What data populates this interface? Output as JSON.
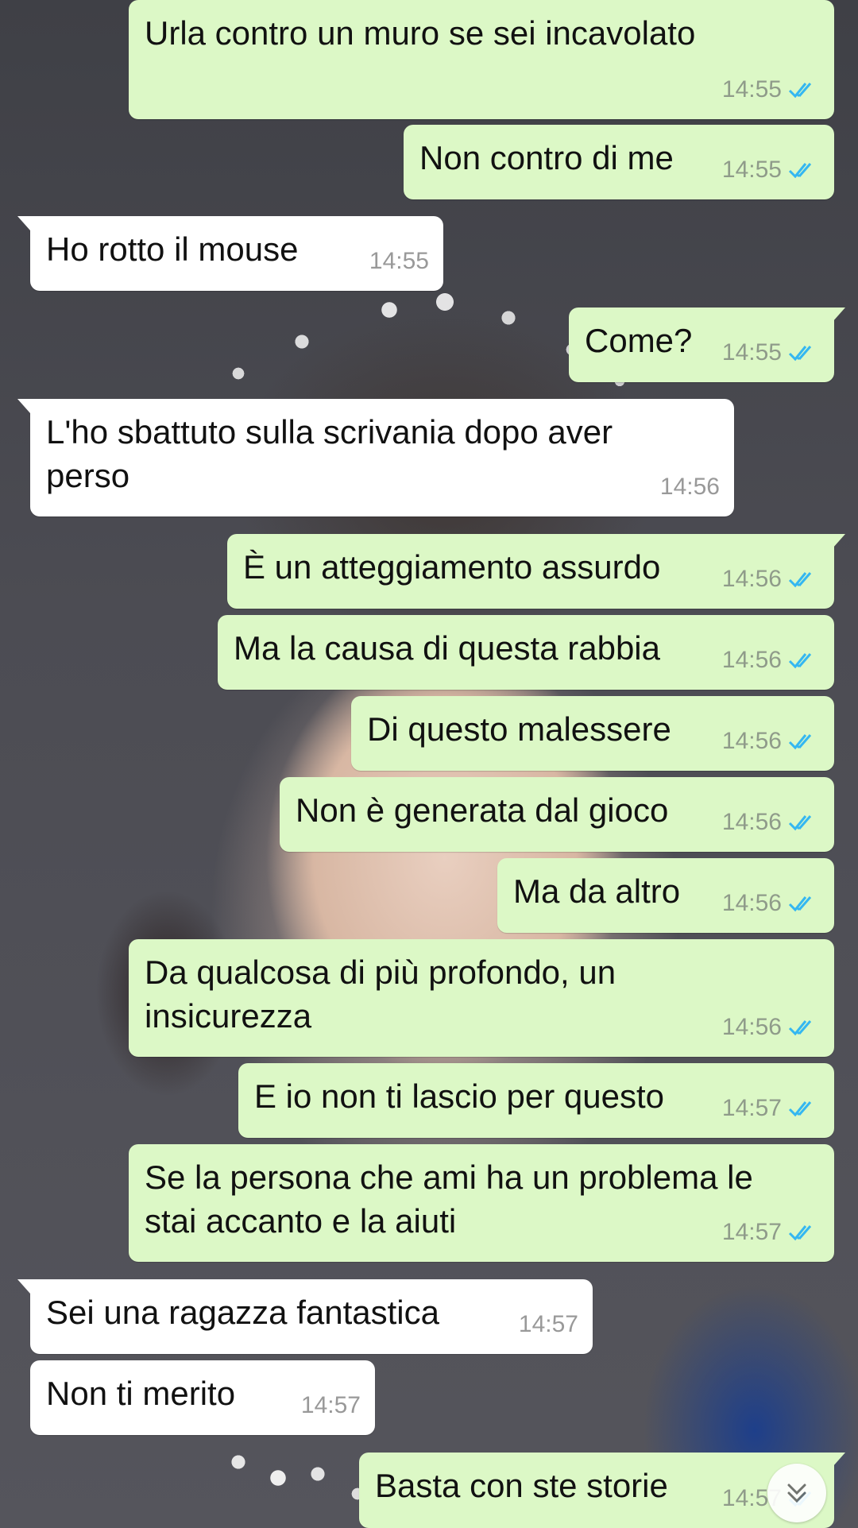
{
  "colors": {
    "outgoing_bubble": "#dcf8c6",
    "incoming_bubble": "#ffffff",
    "read_ticks": "#34b7f1"
  },
  "messages": [
    {
      "dir": "out",
      "text": "Urla contro un muro se sei incavolato",
      "time": "14:55",
      "read": true
    },
    {
      "dir": "out",
      "text": "Non contro di me",
      "time": "14:55",
      "read": true
    },
    {
      "dir": "in",
      "text": "Ho rotto il mouse",
      "time": "14:55"
    },
    {
      "dir": "out",
      "text": "Come?",
      "time": "14:55",
      "read": true
    },
    {
      "dir": "in",
      "text": "L'ho sbattuto sulla scrivania dopo aver\nperso",
      "time": "14:56"
    },
    {
      "dir": "out",
      "text": "È un atteggiamento assurdo",
      "time": "14:56",
      "read": true
    },
    {
      "dir": "out",
      "text": "Ma la causa di questa rabbia",
      "time": "14:56",
      "read": true
    },
    {
      "dir": "out",
      "text": "Di questo malessere",
      "time": "14:56",
      "read": true
    },
    {
      "dir": "out",
      "text": "Non è generata dal gioco",
      "time": "14:56",
      "read": true
    },
    {
      "dir": "out",
      "text": "Ma da altro",
      "time": "14:56",
      "read": true
    },
    {
      "dir": "out",
      "text": "Da qualcosa di più profondo, un\ninsicurezza",
      "time": "14:56",
      "read": true
    },
    {
      "dir": "out",
      "text": "E io non ti lascio per questo",
      "time": "14:57",
      "read": true
    },
    {
      "dir": "out",
      "text": "Se la persona che ami ha un problema le\nstai accanto e la aiuti",
      "time": "14:57",
      "read": true
    },
    {
      "dir": "in",
      "text": "Sei una ragazza fantastica",
      "time": "14:57"
    },
    {
      "dir": "in",
      "text": "Non ti merito",
      "time": "14:57"
    },
    {
      "dir": "out",
      "text": "Basta con ste storie",
      "time": "14:57",
      "read": true
    }
  ],
  "scroll_button": {
    "icon": "double-chevron-down-icon"
  }
}
